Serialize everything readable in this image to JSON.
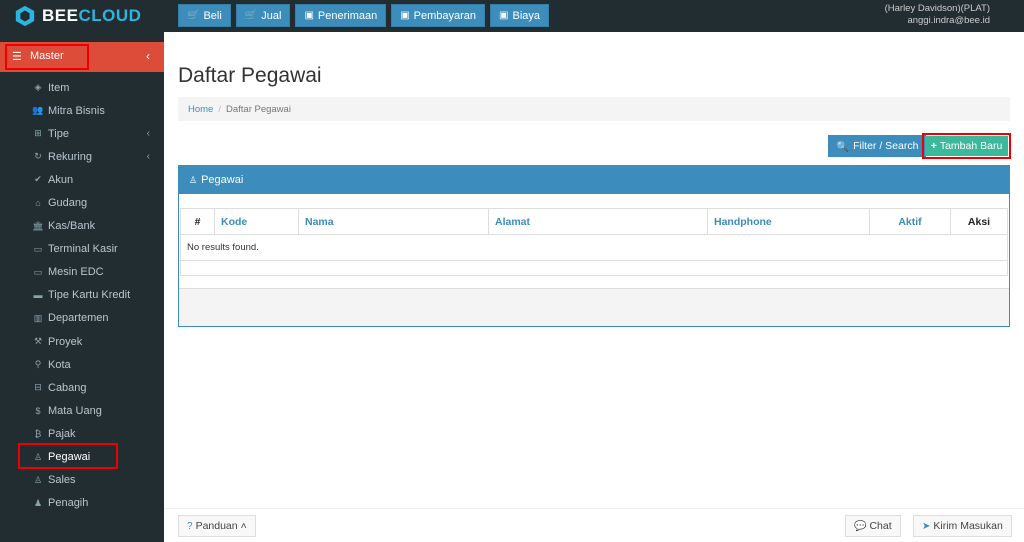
{
  "brand": {
    "name_part1": "BEE",
    "name_part2": "CLOUD",
    "logo_icon": "hexagon-logo-icon"
  },
  "topnav": [
    {
      "label": "Beli",
      "icon": "cart-icon"
    },
    {
      "label": "Jual",
      "icon": "cart-icon"
    },
    {
      "label": "Penerimaan",
      "icon": "money-icon"
    },
    {
      "label": "Pembayaran",
      "icon": "money-icon"
    },
    {
      "label": "Biaya",
      "icon": "money-icon"
    }
  ],
  "user": {
    "company": "(Harley Davidson)(PLAT)",
    "email": "anggi.indra@bee.id"
  },
  "sidebar": {
    "master_label": "Master",
    "items": [
      {
        "label": "Item",
        "icon": "cube-icon",
        "submenu": false
      },
      {
        "label": "Mitra Bisnis",
        "icon": "users-icon",
        "submenu": false
      },
      {
        "label": "Tipe",
        "icon": "sitemap-icon",
        "submenu": true
      },
      {
        "label": "Rekuring",
        "icon": "refresh-icon",
        "submenu": true
      },
      {
        "label": "Akun",
        "icon": "check-icon",
        "submenu": false
      },
      {
        "label": "Gudang",
        "icon": "home-icon",
        "submenu": false
      },
      {
        "label": "Kas/Bank",
        "icon": "bank-icon",
        "submenu": false
      },
      {
        "label": "Terminal Kasir",
        "icon": "desktop-icon",
        "submenu": false
      },
      {
        "label": "Mesin EDC",
        "icon": "monitor-icon",
        "submenu": false
      },
      {
        "label": "Tipe Kartu Kredit",
        "icon": "credit-card-icon",
        "submenu": false
      },
      {
        "label": "Departemen",
        "icon": "building-icon",
        "submenu": false
      },
      {
        "label": "Proyek",
        "icon": "gavel-icon",
        "submenu": false
      },
      {
        "label": "Kota",
        "icon": "map-pin-icon",
        "submenu": false
      },
      {
        "label": "Cabang",
        "icon": "branch-icon",
        "submenu": false
      },
      {
        "label": "Mata Uang",
        "icon": "dollar-icon",
        "submenu": false
      },
      {
        "label": "Pajak",
        "icon": "bitcoin-icon",
        "submenu": false
      },
      {
        "label": "Pegawai",
        "icon": "person-icon",
        "submenu": false,
        "active": true
      },
      {
        "label": "Sales",
        "icon": "person-icon",
        "submenu": false
      },
      {
        "label": "Penagih",
        "icon": "user-icon",
        "submenu": false
      }
    ]
  },
  "page": {
    "title": "Daftar Pegawai",
    "breadcrumb": {
      "home": "Home",
      "current": "Daftar Pegawai"
    },
    "filter_label": "Filter / Search",
    "add_label": "Tambah Baru",
    "panel_title": "Pegawai",
    "table": {
      "headers": {
        "num": "#",
        "kode": "Kode",
        "nama": "Nama",
        "alamat": "Alamat",
        "handphone": "Handphone",
        "aktif": "Aktif",
        "aksi": "Aksi"
      },
      "empty_message": "No results found."
    }
  },
  "footer": {
    "panduan": "Panduan",
    "chat": "Chat",
    "kirim": "Kirim Masukan"
  },
  "colors": {
    "primary": "#3c8dbc",
    "danger": "#dd4b39",
    "success": "#3cb89a",
    "sidebar": "#222d32"
  }
}
